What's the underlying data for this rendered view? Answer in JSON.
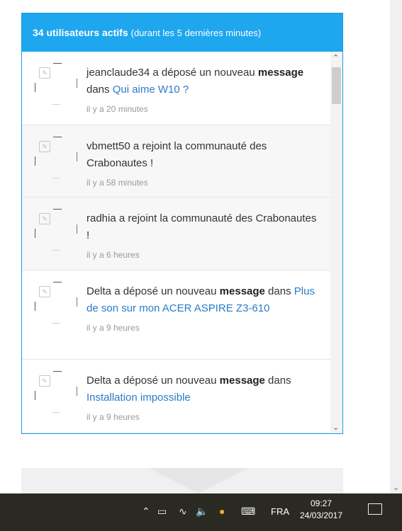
{
  "header": {
    "count_label": "34 utilisateurs actifs",
    "subtitle": "(durant les 5 dernières minutes)"
  },
  "feed": [
    {
      "user": "jeanclaude34",
      "text_before": " a déposé un nouveau ",
      "bold": "message",
      "text_after": " dans ",
      "link": "Qui aime W10 ?",
      "time": "il y a 20 minutes"
    },
    {
      "user": "vbmett50",
      "text_before": " a rejoint la communauté des Crabonautes !",
      "bold": "",
      "text_after": "",
      "link": "",
      "time": "il y a 58 minutes"
    },
    {
      "user": "radhia",
      "text_before": " a rejoint la communauté des Crabonautes !",
      "bold": "",
      "text_after": "",
      "link": "",
      "time": "il y a 6 heures"
    },
    {
      "user": "Delta",
      "text_before": " a déposé un nouveau ",
      "bold": "message",
      "text_after": " dans ",
      "link": "Plus de son sur mon ACER ASPIRE Z3-610",
      "time": "il y a 9 heures"
    },
    {
      "user": "Delta",
      "text_before": " a déposé un nouveau ",
      "bold": "message",
      "text_after": " dans ",
      "link": "Installation impossible",
      "time": "il y a 9 heures"
    }
  ],
  "taskbar": {
    "icons": [
      "chevron-up-icon",
      "battery-icon",
      "wifi-icon",
      "speaker-icon",
      "weather-icon",
      "keyboard-icon"
    ],
    "language": "FRA",
    "time": "09:27",
    "date": "24/03/2017"
  },
  "colors": {
    "header_bg": "#1ea6ef",
    "link": "#2a7cc7",
    "taskbar_bg": "#2b2a22"
  }
}
